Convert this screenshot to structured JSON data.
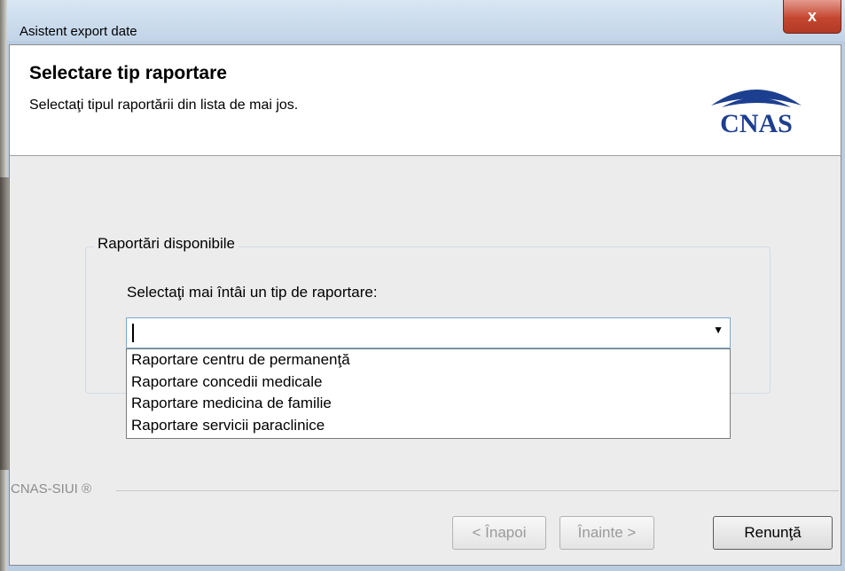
{
  "window": {
    "title": "Asistent export date",
    "close_label": "x"
  },
  "header": {
    "title": "Selectare tip raportare",
    "subtitle": "Selectaţi tipul raportării din lista de mai jos.",
    "logo_text": "CNAS"
  },
  "groupbox": {
    "legend": "Raportări disponibile",
    "prompt": "Selectaţi mai întâi un tip de raportare:"
  },
  "combo": {
    "value": "",
    "arrow_icon": "dropdown-arrow-icon",
    "options": [
      "Raportare centru de permanenţă",
      "Raportare concedii medicale",
      "Raportare medicina de familie",
      "Raportare servicii paraclinice"
    ]
  },
  "footer": {
    "brand": "CNAS-SIUI ®"
  },
  "buttons": {
    "back": "< Înapoi",
    "next": "Înainte >",
    "cancel": "Renunţă"
  },
  "colors": {
    "logo_blue": "#1d3f8f",
    "close_red": "#c4462f",
    "focus_blue": "#7aa7d4"
  }
}
